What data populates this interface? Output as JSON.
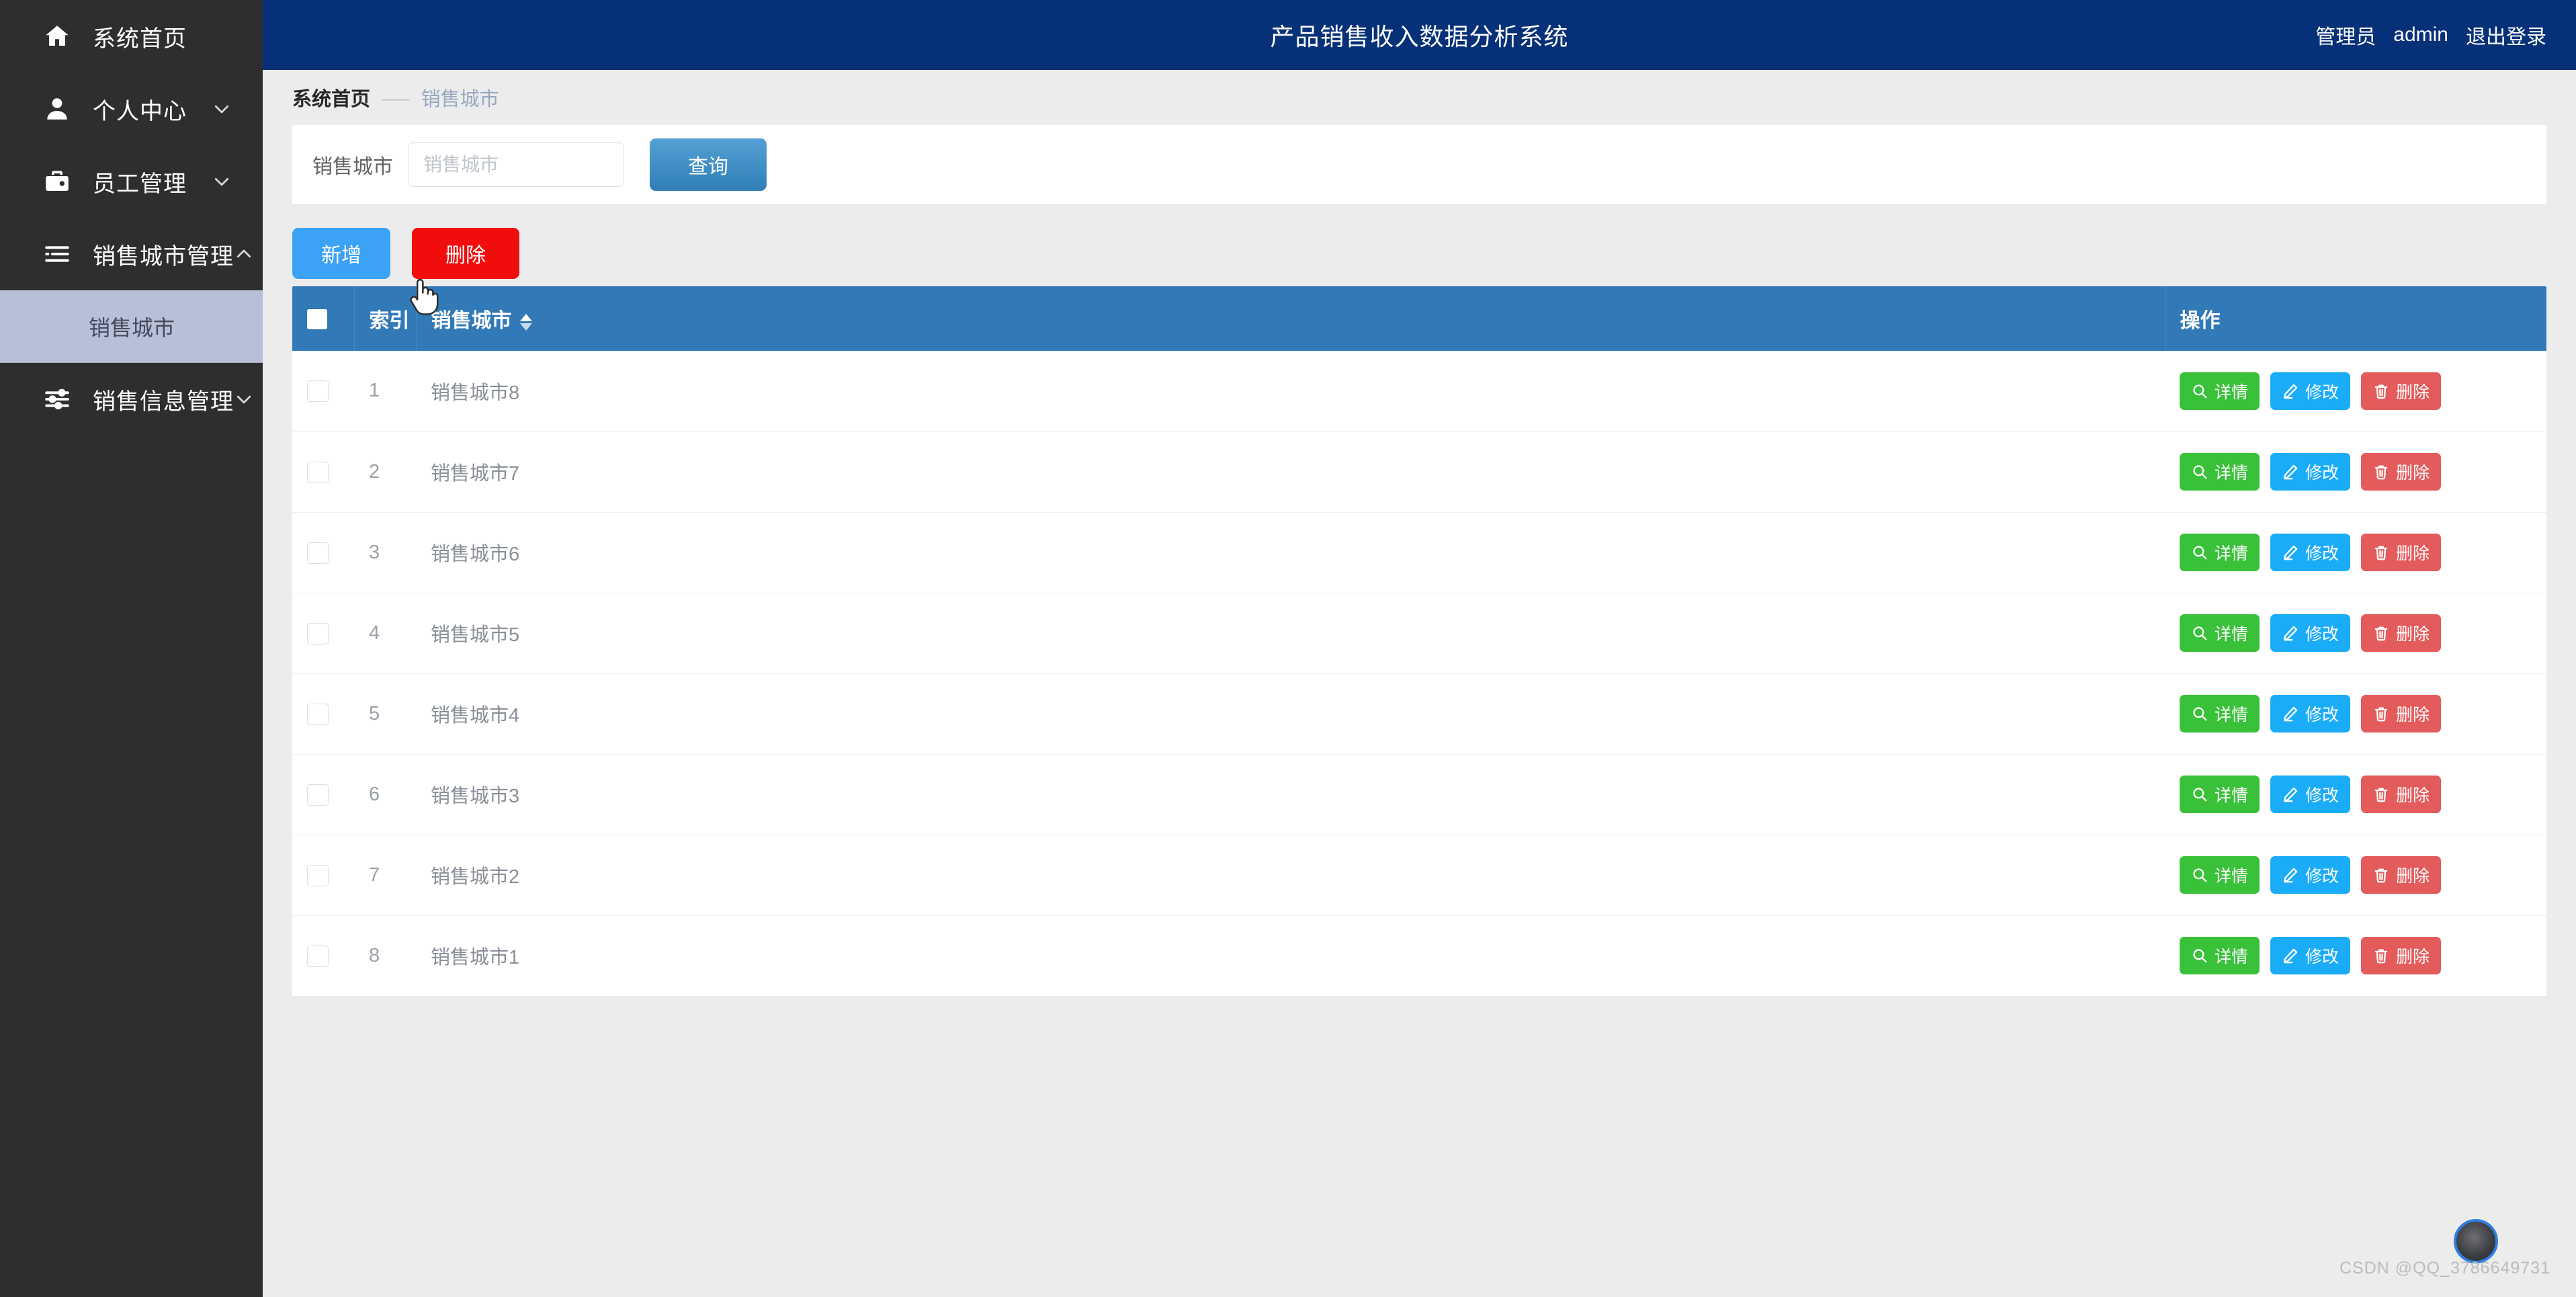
{
  "header": {
    "title": "产品销售收入数据分析系统",
    "user_role": "管理员",
    "user_name": "admin",
    "logout_label": "退出登录",
    "bg_color": "#063178"
  },
  "sidebar": {
    "bg_color": "#2e2e2e",
    "active_bg_color": "#b8c0d8",
    "items": [
      {
        "label": "系统首页",
        "icon": "home-icon",
        "has_chevron": false,
        "expanded": false
      },
      {
        "label": "个人中心",
        "icon": "user-icon",
        "has_chevron": true,
        "expanded": false
      },
      {
        "label": "员工管理",
        "icon": "briefcase-icon",
        "has_chevron": true,
        "expanded": false
      },
      {
        "label": "销售城市管理",
        "icon": "list-icon",
        "has_chevron": true,
        "expanded": true
      },
      {
        "label": "销售信息管理",
        "icon": "sliders-icon",
        "has_chevron": true,
        "expanded": false
      }
    ],
    "sub_items": [
      {
        "label": "销售城市",
        "parent_index": 3,
        "active": true
      }
    ]
  },
  "breadcrumb": {
    "home": "系统首页",
    "separator": "⸺",
    "current": "销售城市"
  },
  "search": {
    "field_label": "销售城市",
    "placeholder": "销售城市",
    "value": "",
    "query_label": "查询",
    "query_color": "#2f7fb8"
  },
  "actions": {
    "add_label": "新增",
    "add_color": "#3ca2f5",
    "delete_label": "删除",
    "delete_color": "#f20d0d"
  },
  "table": {
    "header_color": "#3279b7",
    "columns": {
      "select_all": "",
      "index": "索引",
      "city": "销售城市",
      "ops": "操作"
    },
    "sortable_column": "销售城市",
    "row_buttons": {
      "detail": {
        "label": "详情",
        "icon": "search-icon",
        "color": "#3ac13a"
      },
      "edit": {
        "label": "修改",
        "icon": "pencil-icon",
        "color": "#1bacf7"
      },
      "delete": {
        "label": "删除",
        "icon": "trash-icon",
        "color": "#e35b5b"
      }
    },
    "rows": [
      {
        "index": "1",
        "city": "销售城市8",
        "checked": false
      },
      {
        "index": "2",
        "city": "销售城市7",
        "checked": false
      },
      {
        "index": "3",
        "city": "销售城市6",
        "checked": false
      },
      {
        "index": "4",
        "city": "销售城市5",
        "checked": false
      },
      {
        "index": "5",
        "city": "销售城市4",
        "checked": false
      },
      {
        "index": "6",
        "city": "销售城市3",
        "checked": false
      },
      {
        "index": "7",
        "city": "销售城市2",
        "checked": false
      },
      {
        "index": "8",
        "city": "销售城市1",
        "checked": false
      }
    ]
  },
  "watermark": {
    "text": "CSDN @QQ_3786649731"
  }
}
